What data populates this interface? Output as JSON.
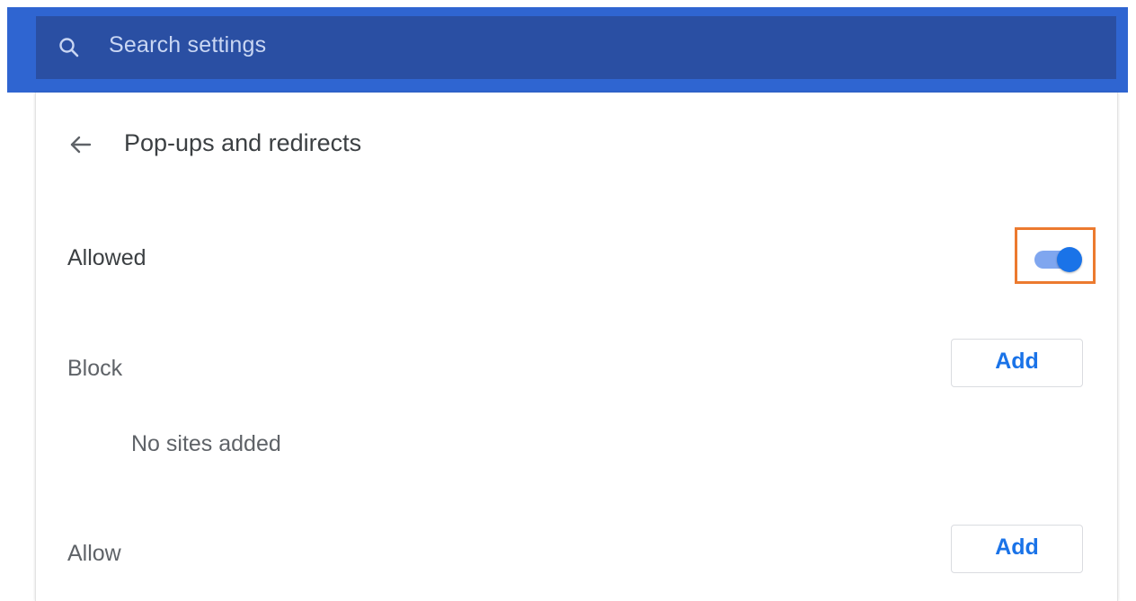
{
  "search": {
    "placeholder": "Search settings"
  },
  "page": {
    "title": "Pop-ups and redirects"
  },
  "main_setting": {
    "label": "Allowed",
    "enabled": true
  },
  "sections": {
    "block": {
      "label": "Block",
      "button": "Add",
      "empty": "No sites added"
    },
    "allow": {
      "label": "Allow",
      "button": "Add"
    }
  },
  "icons": {
    "search": "search-icon",
    "back": "arrow-back-icon"
  },
  "colors": {
    "header_blue": "#2f65d1",
    "search_bg": "#2a4fa3",
    "accent": "#1a73e8",
    "highlight": "#ec7a2f"
  }
}
